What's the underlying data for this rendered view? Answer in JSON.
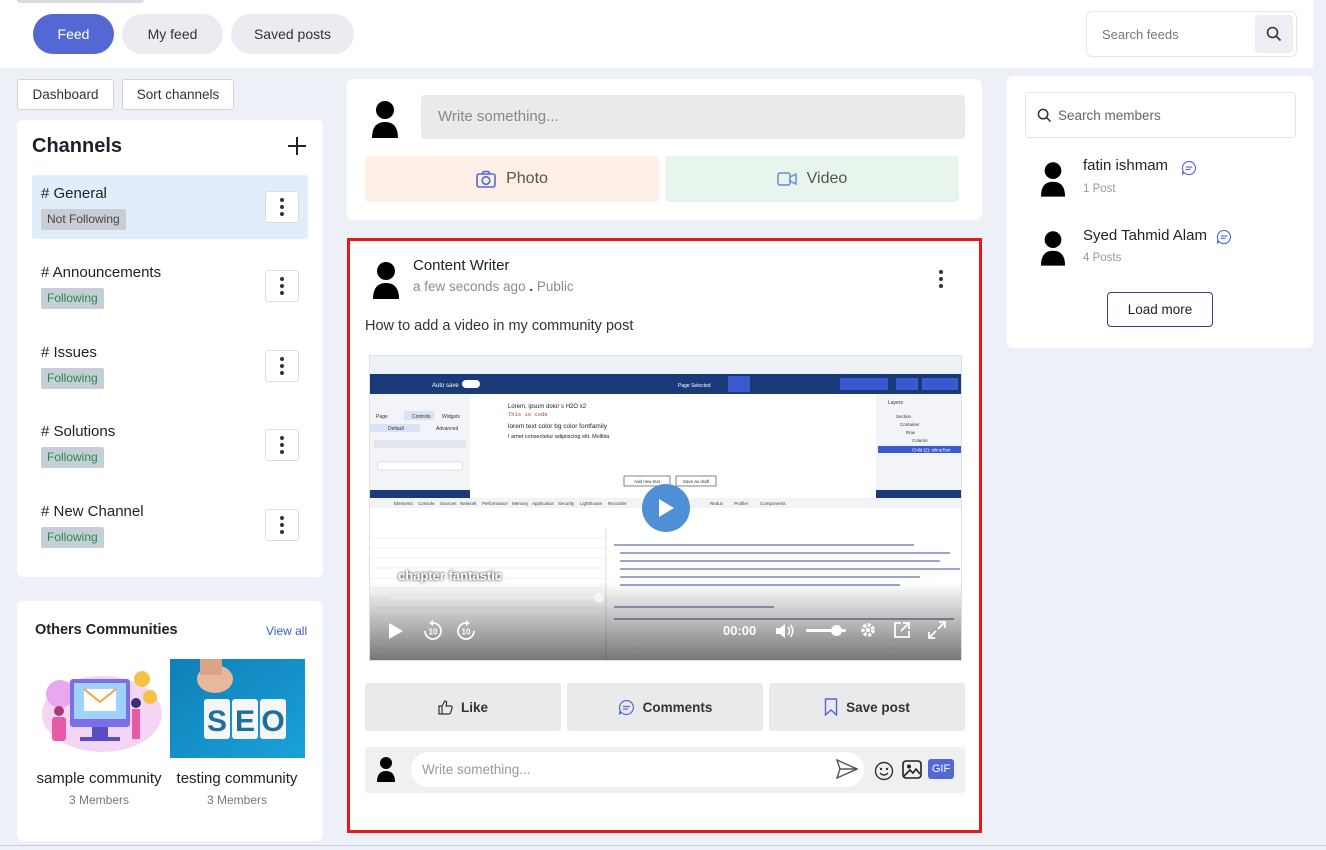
{
  "nav": {
    "tabs": [
      {
        "label": "Feed",
        "active": true
      },
      {
        "label": "My feed",
        "active": false
      },
      {
        "label": "Saved posts",
        "active": false
      }
    ],
    "search_placeholder": "Search feeds"
  },
  "toolbar": {
    "dashboard_label": "Dashboard",
    "sort_channels_label": "Sort channels"
  },
  "channels": {
    "title": "Channels",
    "items": [
      {
        "name": "# General",
        "status": "Not Following",
        "selected": true
      },
      {
        "name": "# Announcements",
        "status": "Following"
      },
      {
        "name": "# Issues",
        "status": "Following"
      },
      {
        "name": "# Solutions",
        "status": "Following"
      },
      {
        "name": "# New Channel",
        "status": "Following"
      }
    ]
  },
  "others": {
    "title": "Others Communities",
    "view_all": "View all",
    "items": [
      {
        "name": "sample community",
        "members": "3 Members",
        "image": "illustration"
      },
      {
        "name": "testing community",
        "members": "3 Members",
        "image": "seo-blocks"
      }
    ]
  },
  "composer": {
    "placeholder": "Write something...",
    "photo_label": "Photo",
    "video_label": "Video"
  },
  "post": {
    "author": "Content Writer",
    "time": "a few seconds ago",
    "separator": ".",
    "visibility": "Public",
    "text": "How to add a video in my community post",
    "video": {
      "caption": "chapter fantastic",
      "time": "00:00",
      "volume": 0.75,
      "editor_tabs": [
        "Page",
        "Controls",
        "Widgets"
      ],
      "editor_subtabs": [
        "Default",
        "Advanced"
      ],
      "autosave_label": "Auto save",
      "page_selected_label": "Page Selected",
      "editor_lines": [
        "Lorem, ipsum dolor s H2O x2",
        "This is code",
        "lorem text color bg color fontfamily",
        "I amet consectetur adipisicing elit. Mollitia"
      ],
      "layers_title": "Layers",
      "layers": [
        "Section",
        "Container",
        "Row",
        "Column",
        "Child (2): InlineText"
      ],
      "buttons": [
        "Add new text",
        "Save as draft"
      ],
      "devtools_tabs": [
        "Elements",
        "Console",
        "Sources",
        "Network",
        "Performance",
        "Memory",
        "Application",
        "Security",
        "Lighthouse",
        "Recorder",
        "Redux",
        "Profiler",
        "Components"
      ]
    },
    "actions": {
      "like": "Like",
      "comments": "Comments",
      "save": "Save post"
    },
    "comment_placeholder": "Write something...",
    "gif_label": "GIF"
  },
  "members": {
    "search_placeholder": "Search members",
    "items": [
      {
        "name": "fatin ishmam",
        "posts": "1 Post"
      },
      {
        "name": "Syed Tahmid Alam",
        "posts": "4 Posts"
      }
    ],
    "load_more": "Load more"
  },
  "colors": {
    "accent": "#5468d4",
    "highlight_border": "#e11a1a",
    "following": "#2b8a3e",
    "photo_bg": "#fdeee6",
    "video_bg": "#e8f5ec"
  }
}
